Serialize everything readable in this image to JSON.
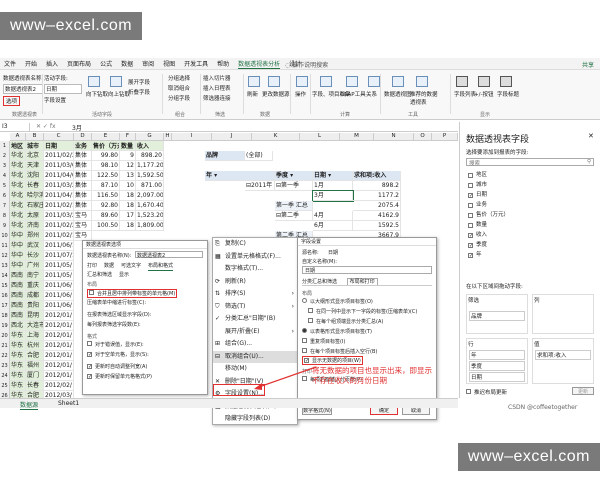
{
  "watermark": "www–excel.com",
  "menu": [
    "文件",
    "开始",
    "插入",
    "页面布局",
    "公式",
    "数据",
    "审阅",
    "视图",
    "开发工具",
    "帮助",
    "数据透视表分析",
    "设计"
  ],
  "menu_active_index": 10,
  "tell_me": "操作说明搜索",
  "share": "共享",
  "ribbon": {
    "pivot_name_label": "数据透视表名称:",
    "pivot_name": "数据透视表2",
    "options": "选项",
    "active_field_label": "活动字段:",
    "active_field": "日期",
    "field_settings": "字段设置",
    "drill_down": "向下钻取",
    "drill_up": "向上钻取",
    "expand_field": "展开字段",
    "collapse_field": "折叠字段",
    "group_selection": "分组选择",
    "ungroup": "取消组合",
    "group_field": "分组字段",
    "insert_slicer": "插入切片器",
    "insert_timeline": "插入日程表",
    "filter_connections": "筛选器连接",
    "refresh": "刷新",
    "change_source": "更改数据源",
    "actions": "操作",
    "fields_items": "字段、项目和集",
    "olap": "OLAP工具",
    "relationships": "关系",
    "pivotchart": "数据透视图",
    "recommended": "推荐的数据透视表",
    "field_list": "字段列表",
    "buttons": "+/-按钮",
    "headers": "字段标题",
    "groups": [
      "数据透视表",
      "活动字段",
      "组合",
      "筛选",
      "数据",
      "",
      "计算",
      "工具",
      "显示"
    ]
  },
  "formula_bar": {
    "name_box": "I3",
    "value": "3月"
  },
  "columns": [
    "A",
    "B",
    "C",
    "D",
    "E",
    "F",
    "G",
    "H",
    "I",
    "J",
    "K",
    "L",
    "M",
    "N",
    "O",
    "P",
    "Q"
  ],
  "table_headers": [
    "地区",
    "城市",
    "日期",
    "业务",
    "售价（万元）",
    "数量",
    "收入"
  ],
  "rows": [
    [
      "华北",
      "北京",
      "2011/02/23",
      "集体",
      "99.80",
      "9",
      "898.20"
    ],
    [
      "华北",
      "天津",
      "2011/03/04",
      "集体",
      "98.10",
      "12",
      "1,177.20"
    ],
    [
      "华北",
      "沈阳",
      "2011/04/05",
      "集体",
      "122.50",
      "13",
      "1,592.50"
    ],
    [
      "华北",
      "长春",
      "2011/03/24",
      "集体",
      "87.10",
      "10",
      "871.00"
    ],
    [
      "华北",
      "哈尔滨",
      "2011/04/14",
      "集体",
      "116.50",
      "18",
      "2,097.00"
    ],
    [
      "华北",
      "石家庄",
      "2011/02/16",
      "集体",
      "92.80",
      "18",
      "1,670.40"
    ],
    [
      "华北",
      "太原",
      "2011/03/29",
      "宝马",
      "89.60",
      "17",
      "1,523.20"
    ],
    [
      "华北",
      "济南",
      "2011/02/21",
      "宝马",
      "100.50",
      "18",
      "1,809.00"
    ],
    [
      "华中",
      "郑州",
      "2011/02/15",
      "宝马",
      "",
      "",
      ""
    ],
    [
      "华中",
      "武汉",
      "2011/06/1",
      "",
      "",
      "",
      ""
    ],
    [
      "华中",
      "长沙",
      "2011/07/1",
      "",
      "",
      "",
      ""
    ],
    [
      "华中",
      "广州",
      "2011/05/",
      "",
      "",
      "",
      ""
    ],
    [
      "西南",
      "南宁",
      "2011/05/",
      "",
      "",
      "",
      ""
    ],
    [
      "西南",
      "重庆",
      "2011/06/",
      "",
      "",
      "",
      ""
    ],
    [
      "西南",
      "成都",
      "2011/06/",
      "",
      "",
      "",
      ""
    ],
    [
      "西南",
      "贵阳",
      "2011/06/",
      "",
      "",
      "",
      ""
    ],
    [
      "西南",
      "昆明",
      "2012/01/",
      "",
      "",
      "",
      ""
    ],
    [
      "西北",
      "大连市",
      "2012/01/",
      "",
      "",
      "",
      ""
    ],
    [
      "华东",
      "上海",
      "2012/01/",
      "",
      "",
      "",
      ""
    ],
    [
      "华东",
      "杭州",
      "2012/01/",
      "",
      "",
      "",
      ""
    ],
    [
      "华东",
      "合肥",
      "2012/01/",
      "",
      "",
      "",
      ""
    ],
    [
      "华东",
      "福州",
      "2012/01/",
      "",
      "",
      "",
      ""
    ],
    [
      "华东",
      "厦门",
      "2012/01/",
      "",
      "",
      "",
      ""
    ],
    [
      "华东",
      "长春",
      "2012/02/",
      "",
      "",
      "",
      ""
    ],
    [
      "华东",
      "合肥",
      "2012/03/",
      "",
      "",
      "",
      ""
    ],
    [
      "华东",
      "厦门市",
      "2012/03/",
      "",
      "",
      "",
      ""
    ]
  ],
  "pivot": {
    "brand_label": "品牌",
    "all": "(全部)",
    "year_label": "年",
    "year_value": "2011年",
    "quarter_label": "季度",
    "date_label": "日期",
    "sum_label": "求和项:收入",
    "items": [
      [
        "第一季",
        "1月",
        "898.2"
      ],
      [
        "",
        "3月",
        "1177.2"
      ],
      [
        "第一季 汇总",
        "",
        "2075.4"
      ],
      [
        "第二季",
        "4月",
        "4162.9"
      ],
      [
        "",
        "6月",
        "1592.5"
      ],
      [
        "第二季 汇总",
        "",
        "3667.9"
      ]
    ],
    "year_total_label": "2011年 汇总",
    "year_total": "5743.3",
    "grand": "总计"
  },
  "context_menu": [
    "复制(C)",
    "设置单元格格式(F)...",
    "数字格式(T)...",
    "刷新(R)",
    "排序(S)",
    "筛选(T)",
    "分类汇总\"日期\"(B)",
    "展开/折叠(E)",
    "组合(G)...",
    "取消组合(U)...",
    "移动(M)",
    "删除\"日期\"(V)",
    "字段设置(N)...",
    "数据透视表选项(O)...",
    "隐藏字段列表(D)"
  ],
  "options_dialog": {
    "title": "数据透视表选项",
    "name_label": "数据透视表名称(N):",
    "name": "数据透视表2",
    "tabs": [
      "打印",
      "数据",
      "可选文字",
      "布局和格式",
      "汇总和筛选",
      "显示"
    ],
    "layout": "布局",
    "opt1": "合并且居中排列带标签的单元格(M)",
    "opt2": "压缩表单中缩进行标签(C):",
    "opt3": "在报表筛选区域显示字段(D):",
    "opt4": "每列报表筛选字段数(E):",
    "format": "格式",
    "opt5": "对于错误值，显示(E):",
    "opt6": "对于空单元格，显示(S):",
    "opt7": "更新时自动调整列宽(A)",
    "opt8": "更新时保留单元格格式(P)"
  },
  "field_dialog": {
    "title": "字段设置",
    "source_label": "源名称:",
    "source": "日期",
    "custom_label": "自定义名称(M):",
    "custom": "日期",
    "tabs": [
      "分类汇总和筛选",
      "布局和打印"
    ],
    "layout": "布局",
    "r1": "以大纲形式显示项目标签(O)",
    "r2": "在同一列中显示下一字段的标签(压缩表单)(C)",
    "r3": "在每个组顶端显示分类汇总(A)",
    "r4": "以表格形式显示项目标签(T)",
    "r5": "重复项目标签(I)",
    "r6": "在每个项目标签后插入空行(B)",
    "r7": "显示无数据的项目(W)",
    "print": "打印",
    "r8": "每项后面插入分页符(P)",
    "numfmt": "数字格式(N)",
    "ok": "确定",
    "cancel": "取消"
  },
  "annotation": "将无数据的项目也显示出来，即显示不存在收入的月份日期",
  "field_pane": {
    "title": "数据透视表字段",
    "subtitle": "选择要添加到报表的字段:",
    "search": "搜索",
    "fields": [
      {
        "name": "地区",
        "checked": false
      },
      {
        "name": "城市",
        "checked": false
      },
      {
        "name": "日期",
        "checked": true
      },
      {
        "name": "业务",
        "checked": false
      },
      {
        "name": "售价（万元）",
        "checked": false
      },
      {
        "name": "数量",
        "checked": false
      },
      {
        "name": "收入",
        "checked": true
      },
      {
        "name": "季度",
        "checked": true
      },
      {
        "name": "年",
        "checked": true
      }
    ],
    "drag_label": "在以下区域间拖动字段:",
    "filters": "筛选",
    "columns": "列",
    "rows_area": "行",
    "values": "值",
    "filter_item": "品牌",
    "row_items": [
      "年",
      "季度",
      "日期"
    ],
    "value_item": "求和项:收入",
    "defer": "推迟布局更新",
    "update": "更新"
  },
  "sheet_tabs": [
    "数据源",
    "Sheet1"
  ],
  "credit": "CSDN @coffeetogether",
  "colors": {
    "excel_green": "#217346",
    "red_box": "#e03030",
    "annotation_red": "#e03030"
  }
}
